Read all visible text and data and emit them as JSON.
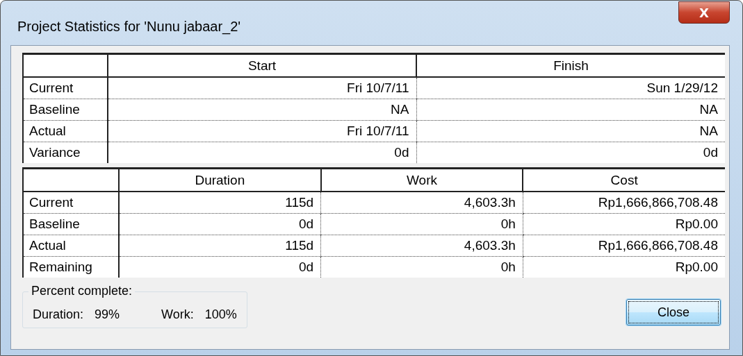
{
  "window": {
    "title": "Project Statistics for 'Nunu jabaar_2'",
    "close_glyph": "X"
  },
  "dates_table": {
    "columns": [
      "Start",
      "Finish"
    ],
    "rows": [
      {
        "label": "Current",
        "values": [
          "Fri 10/7/11",
          "Sun 1/29/12"
        ]
      },
      {
        "label": "Baseline",
        "values": [
          "NA",
          "NA"
        ]
      },
      {
        "label": "Actual",
        "values": [
          "Fri 10/7/11",
          "NA"
        ]
      },
      {
        "label": "Variance",
        "values": [
          "0d",
          "0d"
        ]
      }
    ]
  },
  "totals_table": {
    "columns": [
      "Duration",
      "Work",
      "Cost"
    ],
    "rows": [
      {
        "label": "Current",
        "values": [
          "115d",
          "4,603.3h",
          "Rp1,666,866,708.48"
        ]
      },
      {
        "label": "Baseline",
        "values": [
          "0d",
          "0h",
          "Rp0.00"
        ]
      },
      {
        "label": "Actual",
        "values": [
          "115d",
          "4,603.3h",
          "Rp1,666,866,708.48"
        ]
      },
      {
        "label": "Remaining",
        "values": [
          "0d",
          "0h",
          "Rp0.00"
        ]
      }
    ]
  },
  "percent_complete": {
    "title": "Percent complete:",
    "items": [
      {
        "label": "Duration:",
        "value": "99%"
      },
      {
        "label": "Work:",
        "value": "100%"
      }
    ]
  },
  "buttons": [
    {
      "label": "Close",
      "focused": true
    }
  ]
}
